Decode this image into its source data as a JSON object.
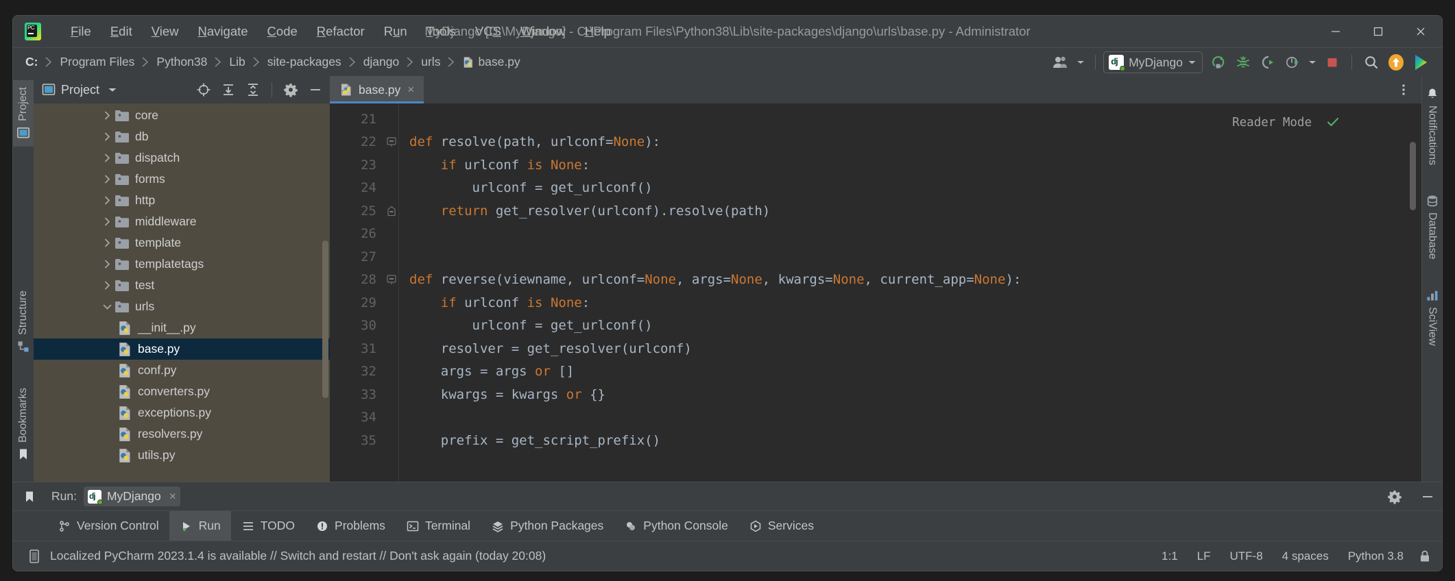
{
  "window": {
    "title": "MyDjango [D:\\MyDjango] - C:\\Program Files\\Python38\\Lib\\site-packages\\django\\urls\\base.py - Administrator",
    "minimize_label": "minimize-icon",
    "maximize_label": "maximize-icon",
    "close_label": "close-icon"
  },
  "menubar": {
    "items": [
      {
        "pre": "",
        "mn": "F",
        "post": "ile"
      },
      {
        "pre": "",
        "mn": "E",
        "post": "dit"
      },
      {
        "pre": "",
        "mn": "V",
        "post": "iew"
      },
      {
        "pre": "",
        "mn": "N",
        "post": "avigate"
      },
      {
        "pre": "",
        "mn": "C",
        "post": "ode"
      },
      {
        "pre": "",
        "mn": "R",
        "post": "efactor"
      },
      {
        "pre": "R",
        "mn": "u",
        "post": "n"
      },
      {
        "pre": "",
        "mn": "T",
        "post": "ools"
      },
      {
        "pre": "VC",
        "mn": "S",
        "post": ""
      },
      {
        "pre": "",
        "mn": "W",
        "post": "indow"
      },
      {
        "pre": "",
        "mn": "H",
        "post": "elp"
      }
    ]
  },
  "navbar": {
    "crumbs": [
      {
        "label": "C:",
        "icon": "drive-icon"
      },
      {
        "label": "Program Files",
        "icon": ""
      },
      {
        "label": "Python38",
        "icon": ""
      },
      {
        "label": "Lib",
        "icon": ""
      },
      {
        "label": "site-packages",
        "icon": ""
      },
      {
        "label": "django",
        "icon": ""
      },
      {
        "label": "urls",
        "icon": ""
      },
      {
        "label": "base.py",
        "icon": "python-file-icon"
      }
    ]
  },
  "toolbar": {
    "account_icon": "user-account-icon",
    "run_config": "MyDjango",
    "run_config_icon": "django-icon",
    "buttons": [
      {
        "name": "run-button",
        "icon": "run-icon"
      },
      {
        "name": "debug-button",
        "icon": "debug-bug-icon"
      },
      {
        "name": "run-with-coverage-button",
        "icon": "coverage-icon"
      },
      {
        "name": "profile-button",
        "icon": "profiler-icon"
      },
      {
        "name": "stop-button",
        "icon": "stop-icon"
      },
      {
        "name": "search-everywhere-button",
        "icon": "search-icon"
      },
      {
        "name": "update-button",
        "icon": "update-arrow-icon"
      },
      {
        "name": "ai-assistant-button",
        "icon": "ai-assistant-icon"
      }
    ]
  },
  "left_strip": {
    "tabs": [
      {
        "label": "Project",
        "icon": "project-icon",
        "selected": true
      },
      {
        "label": "Structure",
        "icon": "structure-icon",
        "selected": false
      },
      {
        "label": "Bookmarks",
        "icon": "bookmark-icon",
        "selected": false
      }
    ]
  },
  "right_strip": {
    "tabs": [
      {
        "label": "Notifications",
        "icon": "notifications-bell-icon"
      },
      {
        "label": "Database",
        "icon": "database-icon"
      },
      {
        "label": "SciView",
        "icon": "sciview-icon"
      }
    ]
  },
  "project_panel": {
    "title": "Project",
    "header_buttons": [
      {
        "name": "select-opened-file-button",
        "icon": "target-icon"
      },
      {
        "name": "expand-all-button",
        "icon": "expand-all-icon"
      },
      {
        "name": "collapse-all-button",
        "icon": "collapse-all-icon"
      },
      {
        "name": "options-button",
        "icon": "gear-icon"
      },
      {
        "name": "hide-button",
        "icon": "minus-icon"
      }
    ],
    "tree": [
      {
        "label": "core",
        "type": "folder",
        "expanded": false,
        "indent": 3,
        "selected": false
      },
      {
        "label": "db",
        "type": "folder",
        "expanded": false,
        "indent": 3,
        "selected": false
      },
      {
        "label": "dispatch",
        "type": "folder",
        "expanded": false,
        "indent": 3,
        "selected": false
      },
      {
        "label": "forms",
        "type": "folder",
        "expanded": false,
        "indent": 3,
        "selected": false
      },
      {
        "label": "http",
        "type": "folder",
        "expanded": false,
        "indent": 3,
        "selected": false
      },
      {
        "label": "middleware",
        "type": "folder",
        "expanded": false,
        "indent": 3,
        "selected": false
      },
      {
        "label": "template",
        "type": "folder",
        "expanded": false,
        "indent": 3,
        "selected": false
      },
      {
        "label": "templatetags",
        "type": "folder",
        "expanded": false,
        "indent": 3,
        "selected": false
      },
      {
        "label": "test",
        "type": "folder",
        "expanded": false,
        "indent": 3,
        "selected": false
      },
      {
        "label": "urls",
        "type": "folder",
        "expanded": true,
        "indent": 3,
        "selected": false
      },
      {
        "label": "__init__.py",
        "type": "python",
        "expanded": null,
        "indent": 4,
        "selected": false
      },
      {
        "label": "base.py",
        "type": "python",
        "expanded": null,
        "indent": 4,
        "selected": true
      },
      {
        "label": "conf.py",
        "type": "python",
        "expanded": null,
        "indent": 4,
        "selected": false
      },
      {
        "label": "converters.py",
        "type": "python",
        "expanded": null,
        "indent": 4,
        "selected": false
      },
      {
        "label": "exceptions.py",
        "type": "python",
        "expanded": null,
        "indent": 4,
        "selected": false
      },
      {
        "label": "resolvers.py",
        "type": "python",
        "expanded": null,
        "indent": 4,
        "selected": false
      },
      {
        "label": "utils.py",
        "type": "python",
        "expanded": null,
        "indent": 4,
        "selected": false
      }
    ]
  },
  "editor": {
    "tab": {
      "label": "base.py",
      "icon": "python-file-icon",
      "close": "×"
    },
    "reader_mode": "Reader Mode",
    "inspection_status": "ok-check-icon",
    "first_line_number": 21,
    "lines": [
      {
        "n": 21,
        "fold": "",
        "tokens": []
      },
      {
        "n": 22,
        "fold": "open",
        "tokens": [
          {
            "t": "def ",
            "c": "kw"
          },
          {
            "t": "resolve",
            "c": "fn"
          },
          {
            "t": "(path, urlconf=",
            "c": ""
          },
          {
            "t": "None",
            "c": "none-lit"
          },
          {
            "t": "):",
            "c": ""
          }
        ]
      },
      {
        "n": 23,
        "fold": "",
        "tokens": [
          {
            "t": "    ",
            "c": ""
          },
          {
            "t": "if ",
            "c": "kw"
          },
          {
            "t": "urlconf ",
            "c": ""
          },
          {
            "t": "is ",
            "c": "kw"
          },
          {
            "t": "None",
            "c": "none-lit"
          },
          {
            "t": ":",
            "c": ""
          }
        ]
      },
      {
        "n": 24,
        "fold": "",
        "tokens": [
          {
            "t": "        urlconf = get_urlconf()",
            "c": ""
          }
        ]
      },
      {
        "n": 25,
        "fold": "close",
        "tokens": [
          {
            "t": "    ",
            "c": ""
          },
          {
            "t": "return ",
            "c": "kw"
          },
          {
            "t": "get_resolver(urlconf).resolve(path)",
            "c": ""
          }
        ]
      },
      {
        "n": 26,
        "fold": "",
        "tokens": []
      },
      {
        "n": 27,
        "fold": "",
        "tokens": []
      },
      {
        "n": 28,
        "fold": "open",
        "tokens": [
          {
            "t": "def ",
            "c": "kw"
          },
          {
            "t": "reverse",
            "c": "fn"
          },
          {
            "t": "(viewname, urlconf=",
            "c": ""
          },
          {
            "t": "None",
            "c": "none-lit"
          },
          {
            "t": ", args=",
            "c": ""
          },
          {
            "t": "None",
            "c": "none-lit"
          },
          {
            "t": ", kwargs=",
            "c": ""
          },
          {
            "t": "None",
            "c": "none-lit"
          },
          {
            "t": ", current_app=",
            "c": ""
          },
          {
            "t": "None",
            "c": "none-lit"
          },
          {
            "t": "):",
            "c": ""
          }
        ]
      },
      {
        "n": 29,
        "fold": "",
        "tokens": [
          {
            "t": "    ",
            "c": ""
          },
          {
            "t": "if ",
            "c": "kw"
          },
          {
            "t": "urlconf ",
            "c": ""
          },
          {
            "t": "is ",
            "c": "kw"
          },
          {
            "t": "None",
            "c": "none-lit"
          },
          {
            "t": ":",
            "c": ""
          }
        ]
      },
      {
        "n": 30,
        "fold": "",
        "tokens": [
          {
            "t": "        urlconf = get_urlconf()",
            "c": ""
          }
        ]
      },
      {
        "n": 31,
        "fold": "",
        "tokens": [
          {
            "t": "    resolver = get_resolver(urlconf)",
            "c": ""
          }
        ]
      },
      {
        "n": 32,
        "fold": "",
        "tokens": [
          {
            "t": "    args = args ",
            "c": ""
          },
          {
            "t": "or ",
            "c": "kw"
          },
          {
            "t": "[]",
            "c": ""
          }
        ]
      },
      {
        "n": 33,
        "fold": "",
        "tokens": [
          {
            "t": "    kwargs = kwargs ",
            "c": ""
          },
          {
            "t": "or ",
            "c": "kw"
          },
          {
            "t": "{}",
            "c": ""
          }
        ]
      },
      {
        "n": 34,
        "fold": "",
        "tokens": []
      },
      {
        "n": 35,
        "fold": "",
        "tokens": [
          {
            "t": "    prefix = get_script_prefix()",
            "c": ""
          }
        ]
      }
    ]
  },
  "run_panel": {
    "label": "Run:",
    "config_name": "MyDjango",
    "config_icon": "django-icon",
    "close": "×",
    "settings_icon": "gear-icon",
    "hide_icon": "minus-icon"
  },
  "bottom_tabs": [
    {
      "label": "Version Control",
      "icon": "branch-icon",
      "selected": false
    },
    {
      "label": "Run",
      "icon": "run-triangle-icon",
      "selected": true
    },
    {
      "label": "TODO",
      "icon": "todo-list-icon",
      "selected": false
    },
    {
      "label": "Problems",
      "icon": "problems-icon",
      "selected": false
    },
    {
      "label": "Terminal",
      "icon": "terminal-icon",
      "selected": false
    },
    {
      "label": "Python Packages",
      "icon": "packages-icon",
      "selected": false
    },
    {
      "label": "Python Console",
      "icon": "python-console-icon",
      "selected": false
    },
    {
      "label": "Services",
      "icon": "services-icon",
      "selected": false
    }
  ],
  "statusbar": {
    "notification_icon": "notification-doc-icon",
    "message": "Localized PyCharm 2023.1.4 is available // Switch and restart // Don't ask again (today 20:08)",
    "caret_position": "1:1",
    "line_separator": "LF",
    "encoding": "UTF-8",
    "indent": "4 spaces",
    "interpreter": "Python 3.8",
    "lock_icon": "lock-icon"
  },
  "colors": {
    "accent_blue": "#4a88c7",
    "selection_blue": "#0d293e",
    "panel_bg": "#3c3f41",
    "tree_bg": "#4f4b41",
    "editor_bg": "#2b2b2b",
    "keyword_orange": "#cc7832",
    "identifier_gray": "#a9b7c6",
    "stop_red": "#c75450",
    "run_green": "#59a869",
    "update_orange": "#f0a732"
  }
}
